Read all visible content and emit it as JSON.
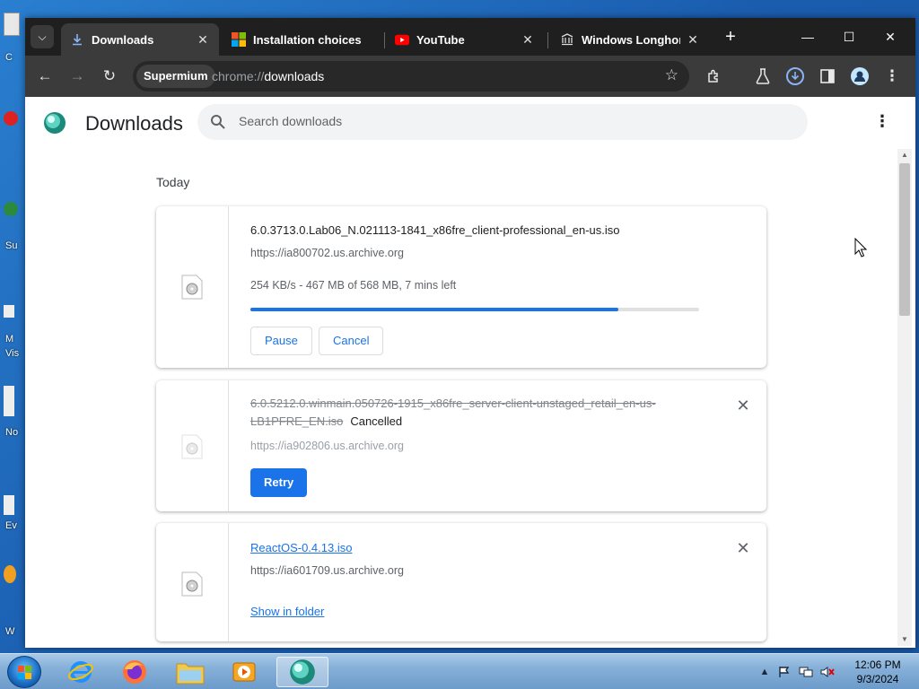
{
  "desktop": {
    "labels": [
      "C",
      "Su",
      "M",
      "Vis",
      "No",
      "Ev",
      "W"
    ]
  },
  "browser": {
    "tabs": [
      {
        "title": "Downloads",
        "active": true,
        "icon": "download-icon"
      },
      {
        "title": "Installation choices",
        "active": false,
        "icon": "windows-logo-icon"
      },
      {
        "title": "YouTube",
        "active": false,
        "icon": "youtube-icon"
      },
      {
        "title": "Windows Longhorn",
        "active": false,
        "icon": "archive-icon"
      }
    ],
    "new_tab_label": "+",
    "window_controls": {
      "minimize": "—",
      "maximize": "☐",
      "close": "✕"
    },
    "toolbar": {
      "site_chip": "Supermium",
      "url_scheme": "chrome://",
      "url_path": "downloads"
    }
  },
  "downloads_page": {
    "title": "Downloads",
    "search_placeholder": "Search downloads",
    "section_label": "Today",
    "items": [
      {
        "file_name": "6.0.3713.0.Lab06_N.021113-1841_x86fre_client-professional_en-us.iso",
        "url": "https://ia800702.us.archive.org",
        "progress_text": "254 KB/s - 467 MB of 568 MB, 7 mins left",
        "progress_percent": 82,
        "buttons": [
          "Pause",
          "Cancel"
        ]
      },
      {
        "file_name": "6.0.5212.0.winmain.050726-1915_x86fre_server-client-unstaged_retail_en-us-LB1PFRE_EN.iso",
        "status": "Cancelled",
        "url": "https://ia902806.us.archive.org",
        "button": "Retry"
      },
      {
        "file_name": "ReactOS-0.4.13.iso",
        "url": "https://ia601709.us.archive.org",
        "link_label": "Show in folder"
      }
    ]
  },
  "taskbar": {
    "apps": [
      "internet-explorer",
      "firefox",
      "file-explorer",
      "media-player",
      "supermium"
    ],
    "clock_time": "12:06 PM",
    "clock_date": "9/3/2024"
  },
  "colors": {
    "accent": "#1a73e8",
    "tabstrip": "#1f1f1f",
    "toolbar": "#3b3b3b"
  }
}
